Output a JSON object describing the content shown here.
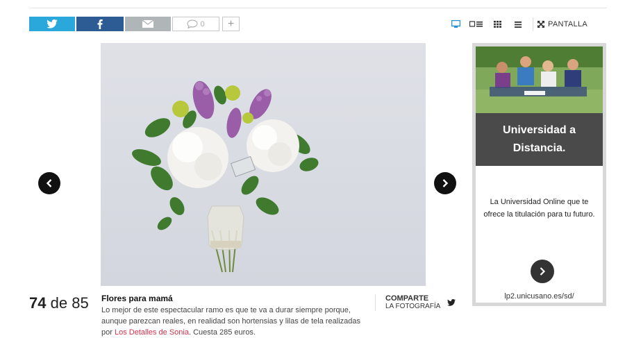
{
  "toolbar": {
    "share_buttons": [
      {
        "network": "twitter",
        "icon": "twitter-icon",
        "color": "#2aa8dc"
      },
      {
        "network": "facebook",
        "icon": "facebook-icon",
        "color": "#2d5b94"
      },
      {
        "network": "email",
        "icon": "envelope-icon",
        "color": "#b0b5b8"
      }
    ],
    "comments_count": "0",
    "add_label": "+",
    "view_modes": [
      "slideshow-view-icon",
      "list-view-icon",
      "grid-view-icon",
      "menu-view-icon"
    ],
    "fullscreen_label": "PANTALLA"
  },
  "gallery": {
    "current": "74",
    "separator": "de",
    "total": "85",
    "caption_title": "Flores para mamá",
    "caption_text_before": "Lo mejor de este espectacular ramo es que te va a durar siempre porque, aunque parezcan reales, en realidad son hortensias y lilas de tela realizadas por ",
    "caption_link": "Los Detalles de Sonia",
    "caption_text_after": ". Cuesta 285 euros.",
    "share_label_1": "COMPARTE",
    "share_label_2": "LA FOTOGRAFÍA",
    "link_color": "#d0324b"
  },
  "ad": {
    "headline": "Universidad a Distancia.",
    "body": "La Universidad Online que te ofrece la titulación para tu futuro.",
    "url": "lp2.unicusano.es/sd/"
  }
}
